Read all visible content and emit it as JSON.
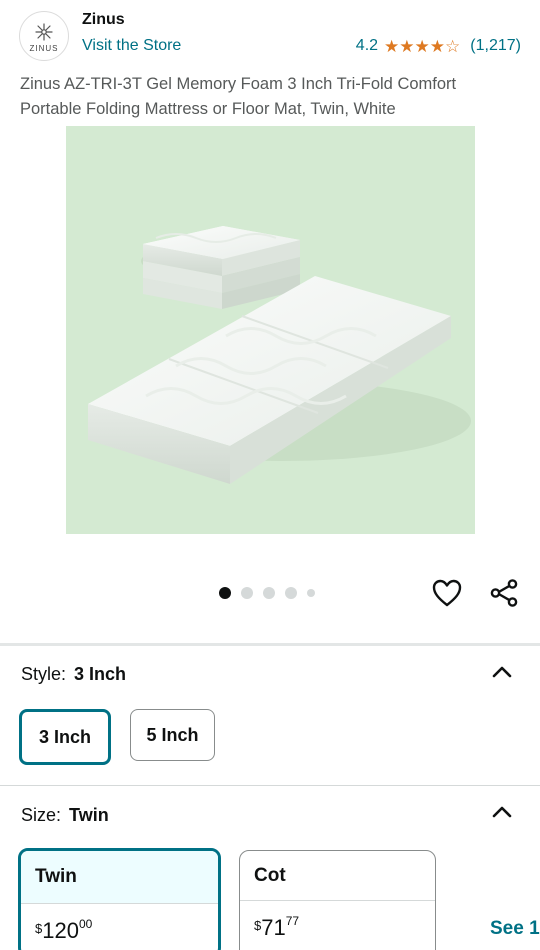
{
  "store": {
    "logo_text": "ZINUS",
    "brand_name": "Zinus",
    "visit_label": "Visit the Store",
    "rating_value": "4.2",
    "star_fill": [
      1,
      1,
      1,
      1,
      0.2
    ],
    "rating_count": "(1,217)"
  },
  "product": {
    "title": "Zinus AZ-TRI-3T Gel Memory Foam 3 Inch Tri-Fold Comfort Portable Folding Mattress or Floor Mat, Twin, White",
    "image_icon": "folded-mattress-image",
    "carousel": {
      "count": 5,
      "active_index": 0
    }
  },
  "actions": {
    "wishlist_icon": "heart-icon",
    "share_icon": "share-icon"
  },
  "style_section": {
    "label": "Style:",
    "selected": "3 Inch",
    "options": [
      "3 Inch",
      "5 Inch"
    ]
  },
  "size_section": {
    "label": "Size:",
    "selected": "Twin",
    "options": [
      {
        "name": "Twin",
        "currency": "$",
        "whole": "120",
        "fraction": "00"
      },
      {
        "name": "Cot",
        "currency": "$",
        "whole": "71",
        "fraction": "77"
      }
    ],
    "see_more_label": "See 1"
  },
  "colors": {
    "link": "#007185",
    "star": "#de7921",
    "image_bg": "#d4ead2",
    "selected_border": "#007185"
  }
}
